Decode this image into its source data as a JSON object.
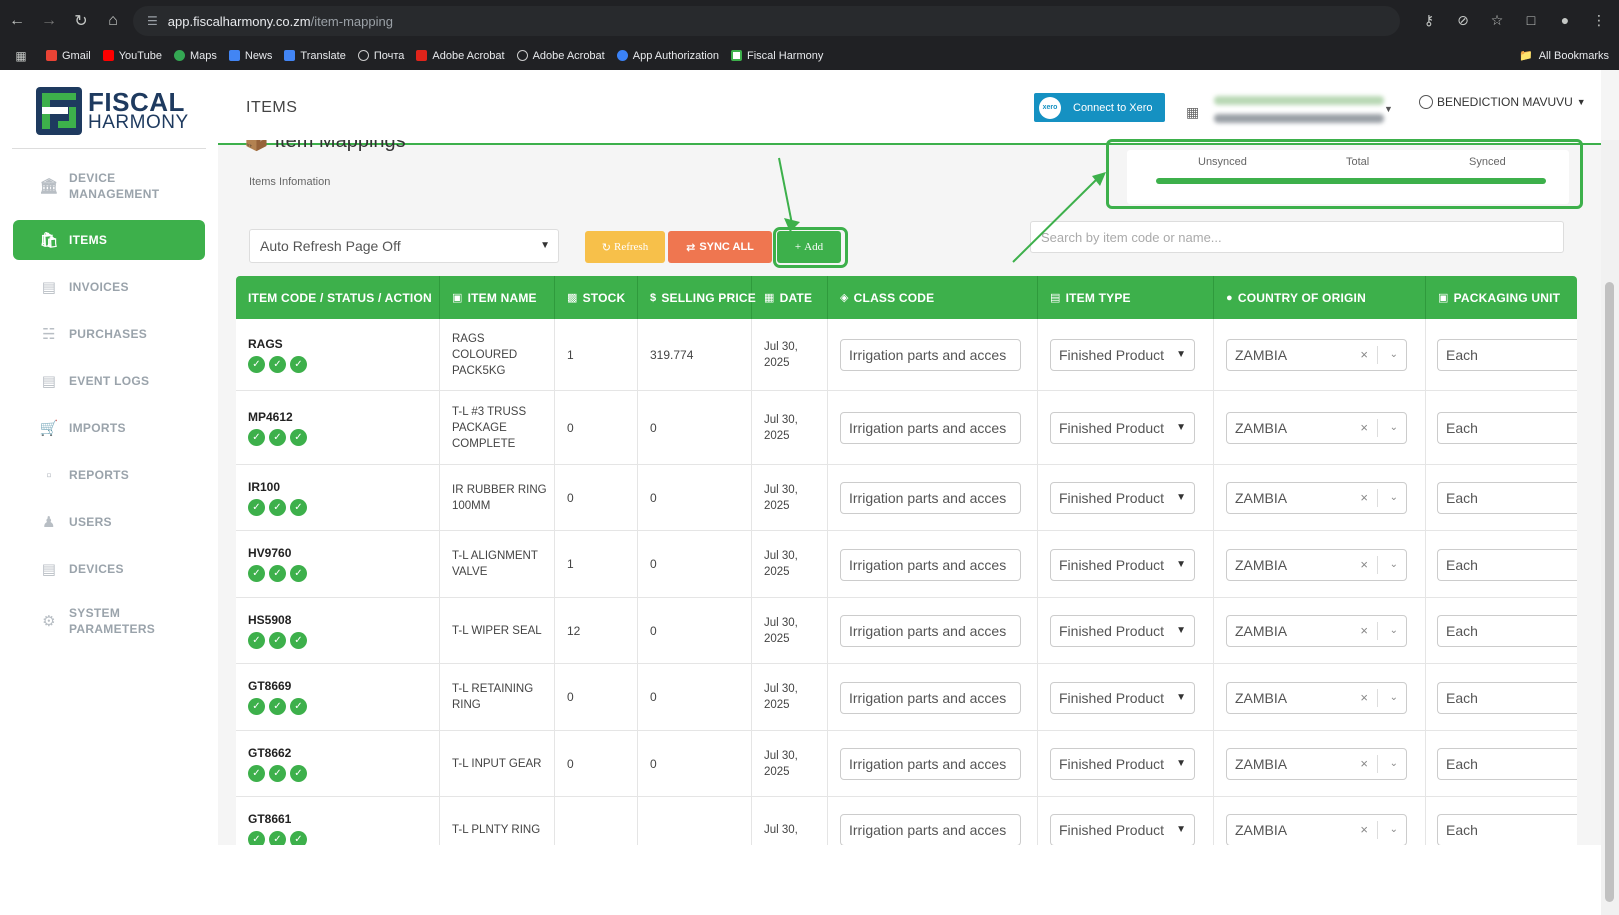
{
  "browser": {
    "url_host": "app.fiscalharmony.co.zm",
    "url_path": "/item-mapping",
    "bookmarks": [
      "Gmail",
      "YouTube",
      "Maps",
      "News",
      "Translate",
      "Почта",
      "Adobe Acrobat",
      "Adobe Acrobat",
      "App Authorization",
      "Fiscal Harmony"
    ],
    "all_bookmarks": "All Bookmarks"
  },
  "logo": {
    "line1": "FISCAL",
    "line2": "HARMONY"
  },
  "sidebar": {
    "items": [
      {
        "label1": "DEVICE",
        "label2": "MANAGEMENT",
        "icon": "bank-icon"
      },
      {
        "label1": "ITEMS",
        "label2": "",
        "icon": "bag-icon"
      },
      {
        "label1": "INVOICES",
        "label2": "",
        "icon": "document-icon"
      },
      {
        "label1": "PURCHASES",
        "label2": "",
        "icon": "basket-icon"
      },
      {
        "label1": "EVENT LOGS",
        "label2": "",
        "icon": "log-icon"
      },
      {
        "label1": "IMPORTS",
        "label2": "",
        "icon": "cart-icon"
      },
      {
        "label1": "REPORTS",
        "label2": "",
        "icon": "bar-chart-icon"
      },
      {
        "label1": "USERS",
        "label2": "",
        "icon": "user-icon"
      },
      {
        "label1": "DEVICES",
        "label2": "",
        "icon": "device-icon"
      },
      {
        "label1": "SYSTEM",
        "label2": "PARAMETERS",
        "icon": "gear-icon"
      }
    ]
  },
  "header": {
    "title": "ITEMS",
    "xero_button": "Connect to Xero",
    "xero_logo": "xero",
    "user": "BENEDICTION MAVUVU"
  },
  "content": {
    "title": "Item Mappings",
    "subtitle": "Items Infomation",
    "auto_refresh": "Auto Refresh Page Off",
    "refresh": "Refresh",
    "sync_all": "SYNC ALL",
    "add": "Add",
    "search_placeholder": "Search by item code or name...",
    "sync": {
      "unsynced": "Unsynced",
      "total": "Total",
      "synced": "Synced"
    }
  },
  "table": {
    "headers": [
      "ITEM CODE / STATUS / ACTION",
      "ITEM NAME",
      "STOCK",
      "SELLING PRICE",
      "DATE",
      "CLASS CODE",
      "ITEM TYPE",
      "COUNTRY OF ORIGIN",
      "PACKAGING UNIT"
    ],
    "rows": [
      {
        "code": "RAGS",
        "name": [
          "RAGS",
          "COLOURED",
          "PACK5KG"
        ],
        "stock": "1",
        "price": "319.774",
        "date": [
          "Jul 30,",
          "2025"
        ],
        "class": "Irrigation parts and acces",
        "type": "Finished Product",
        "country": "ZAMBIA",
        "unit": "Each"
      },
      {
        "code": "MP4612",
        "name": [
          "T-L #3 TRUSS",
          "PACKAGE",
          "COMPLETE"
        ],
        "stock": "0",
        "price": "0",
        "date": [
          "Jul 30,",
          "2025"
        ],
        "class": "Irrigation parts and acces",
        "type": "Finished Product",
        "country": "ZAMBIA",
        "unit": "Each"
      },
      {
        "code": "IR100",
        "name": [
          "IR RUBBER RING",
          "100MM"
        ],
        "stock": "0",
        "price": "0",
        "date": [
          "Jul 30,",
          "2025"
        ],
        "class": "Irrigation parts and acces",
        "type": "Finished Product",
        "country": "ZAMBIA",
        "unit": "Each"
      },
      {
        "code": "HV9760",
        "name": [
          "T-L ALIGNMENT",
          "VALVE"
        ],
        "stock": "1",
        "price": "0",
        "date": [
          "Jul 30,",
          "2025"
        ],
        "class": "Irrigation parts and acces",
        "type": "Finished Product",
        "country": "ZAMBIA",
        "unit": "Each"
      },
      {
        "code": "HS5908",
        "name": [
          "T-L WIPER SEAL"
        ],
        "stock": "12",
        "price": "0",
        "date": [
          "Jul 30,",
          "2025"
        ],
        "class": "Irrigation parts and acces",
        "type": "Finished Product",
        "country": "ZAMBIA",
        "unit": "Each"
      },
      {
        "code": "GT8669",
        "name": [
          "T-L RETAINING",
          "RING"
        ],
        "stock": "0",
        "price": "0",
        "date": [
          "Jul 30,",
          "2025"
        ],
        "class": "Irrigation parts and acces",
        "type": "Finished Product",
        "country": "ZAMBIA",
        "unit": "Each"
      },
      {
        "code": "GT8662",
        "name": [
          "T-L INPUT GEAR"
        ],
        "stock": "0",
        "price": "0",
        "date": [
          "Jul 30,",
          "2025"
        ],
        "class": "Irrigation parts and acces",
        "type": "Finished Product",
        "country": "ZAMBIA",
        "unit": "Each"
      },
      {
        "code": "GT8661",
        "name": [
          "T-L PLNTY RING"
        ],
        "stock": "",
        "price": "",
        "date": [
          "Jul 30,",
          ""
        ],
        "class": "Irrigation parts and acces",
        "type": "Finished Product",
        "country": "ZAMBIA",
        "unit": "Each"
      }
    ]
  }
}
